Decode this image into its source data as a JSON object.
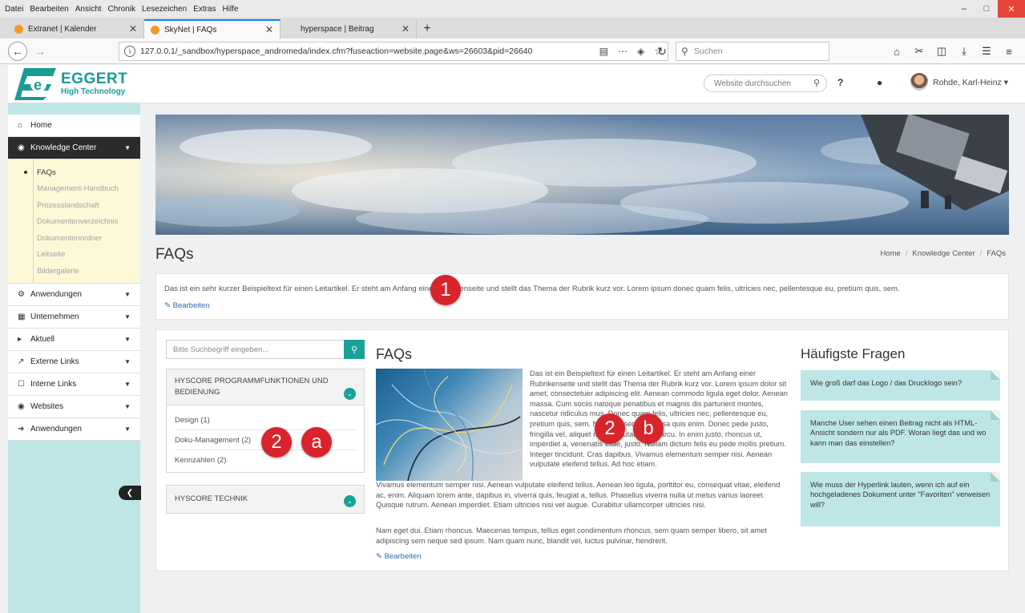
{
  "browser": {
    "menu": [
      "Datei",
      "Bearbeiten",
      "Ansicht",
      "Chronik",
      "Lesezeichen",
      "Extras",
      "Hilfe"
    ],
    "tabs": [
      {
        "title": "Extranet | Kalender"
      },
      {
        "title": "SkyNet | FAQs"
      },
      {
        "title": "hyperspace | Beitrag"
      }
    ],
    "new_tab": "+",
    "url": "127.0.0.1/_sandbox/hyperspace_andromeda/index.cfm?fuseaction=website.page&ws=26603&pid=26640",
    "search_placeholder": "Suchen"
  },
  "header": {
    "logo_name": "EGGERT",
    "logo_tagline": "High Technology",
    "search_placeholder": "Website durchsuchen",
    "help": "?",
    "user_name": "Rohde, Karl-Heinz"
  },
  "sidebar": {
    "items": [
      {
        "label": "Home",
        "icon": "home-icon"
      },
      {
        "label": "Knowledge Center",
        "icon": "lightbulb-icon"
      },
      {
        "label": "Anwendungen",
        "icon": "cogs-icon"
      },
      {
        "label": "Unternehmen",
        "icon": "building-icon"
      },
      {
        "label": "Aktuell",
        "icon": "megaphone-icon"
      },
      {
        "label": "Externe Links",
        "icon": "external-link-icon"
      },
      {
        "label": "Interne Links",
        "icon": "bookmark-icon"
      },
      {
        "label": "Websites",
        "icon": "globe-icon"
      },
      {
        "label": "Anwendungen",
        "icon": "sign-in-icon"
      }
    ],
    "sub_items": [
      "FAQs",
      "Management-Handbuch",
      "Prozesslandschaft",
      "Dokumentenverzeichnis",
      "Dokumentenordner",
      "Leitseite",
      "Bildergalerie"
    ]
  },
  "page": {
    "title": "FAQs",
    "breadcrumb": [
      "Home",
      "Knowledge Center",
      "FAQs"
    ],
    "intro_text": "Das ist ein sehr kurzer Beispieltext für einen Leitartikel. Er steht am Anfang einer Rubrikenseite und stellt das Thema der Rubrik kurz vor. Lorem ipsum donec quam felis, ultricies nec, pellentesque eu, pretium quis, sem.",
    "edit_label": "Bearbeiten"
  },
  "faq_search": {
    "placeholder": "Bitte Suchbegriff eingeben..."
  },
  "accordion": [
    {
      "title": "HYSCORE PROGRAMMFUNKTIONEN UND BEDIENUNG",
      "items": [
        "Design (1)",
        "Doku-Management (2)",
        "Kennzahlen (2)"
      ]
    },
    {
      "title": "HYSCORE TECHNIK",
      "items": []
    }
  ],
  "article": {
    "heading": "FAQs",
    "para1": "Das ist ein Beispieltext für einen Leitartikel. Er steht am Anfang einer Rubrikenseite und stellt das Thema der Rubrik kurz vor. Lorem ipsum dolor sit amet, consectetuer adipiscing elit. Aenean commodo ligula eget dolor. Aenean massa. Cum sociis natoque penatibus et magnis dis parturient montes, nascetur ridiculus mus. Donec quam felis, ultricies nec, pellentesque eu, pretium quis, sem. Nulla consequat massa quis enim. Donec pede justo, fringilla vel, aliquet nec, vulputate eget, arcu. In enim justo, rhoncus ut, imperdiet a, venenatis vitae, justo. Nullam dictum felis eu pede mollis pretium. Integer tincidunt. Cras dapibus. Vivamus elementum semper nisi. Aenean vulputate eleifend tellus. Ad hoc etiam.",
    "para2": "Vivamus elementum semper nisi. Aenean vulputate eleifend tellus. Aenean leo ligula, porttitor eu, consequat vitae, eleifend ac, enim. Aliquam lorem ante, dapibus in, viverra quis, feugiat a, tellus. Phasellus viverra nulla ut metus varius laoreet. Quisque rutrum. Aenean imperdiet. Etiam ultricies nisi vel augue. Curabitur ullamcorper ultricies nisi.",
    "para3": "Nam eget dui. Etiam rhoncus. Maecenas tempus, tellus eget condimentum rhoncus, sem quam semper libero, sit amet adipiscing sem neque sed ipsum. Nam quam nunc, blandit vel, luctus pulvinar, hendrerit.",
    "edit_label": "Bearbeiten"
  },
  "top_questions": {
    "heading": "Häufigste Fragen",
    "items": [
      "Wie groß darf das Logo / das Drucklogo sein?",
      "Manche User sehen einen Beitrag nicht als HTML-Ansicht sondern nur als PDF. Woran liegt das und wo kann man das einstellen?",
      "Wie muss der Hyperlink lauten, wenn ich auf ein hochgeladenes Dokument unter \"Favoriten\" verweisen will?"
    ]
  },
  "markers": {
    "m1": "1",
    "m2a_num": "2",
    "m2a_letter": "a",
    "m2b_num": "2",
    "m2b_letter": "b"
  },
  "colors": {
    "accent": "#19a29a",
    "sidebar_bg": "#bfe6e6",
    "submenu_bg": "#fdf8d8",
    "marker": "#d9232d"
  }
}
